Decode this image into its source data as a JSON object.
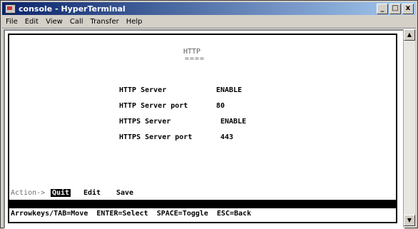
{
  "window": {
    "title": "console - HyperTerminal",
    "buttons": {
      "minimize": "_",
      "maximize": "□",
      "close": "x"
    }
  },
  "menu": [
    "File",
    "Edit",
    "View",
    "Call",
    "Transfer",
    "Help"
  ],
  "terminal": {
    "heading": "HTTP",
    "heading_underline": "====",
    "settings": [
      {
        "label": "HTTP Server",
        "value": "ENABLE"
      },
      {
        "label": "HTTP Server port",
        "value": "80"
      },
      {
        "label": "HTTPS Server",
        "value": "ENABLE"
      },
      {
        "label": "HTTPS Server port",
        "value": "443"
      }
    ],
    "action_prefix": "Action->",
    "actions": [
      "Quit",
      "Edit",
      "Save"
    ],
    "selected_action": "Quit",
    "help_line": "Arrowkeys/TAB=Move  ENTER=Select  SPACE=Toggle  ESC=Back"
  },
  "scrollbar": {
    "up_icon": "up-arrow-icon",
    "down_icon": "down-arrow-icon"
  }
}
